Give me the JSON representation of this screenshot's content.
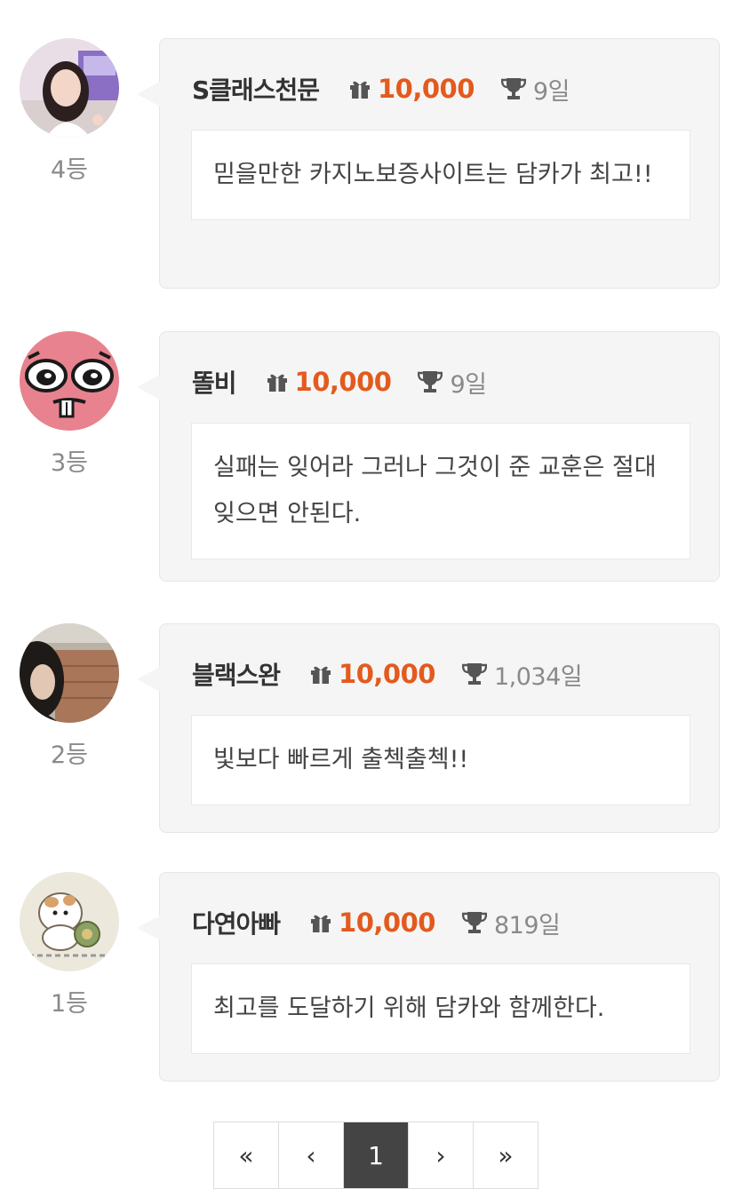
{
  "entries": [
    {
      "name": "S클래스천문",
      "points": "10,000",
      "days": "9일",
      "message": "믿을만한 카지노보증사이트는 담카가 최고!!",
      "rank": "4등",
      "avatar_icon": "profile-photo-woman-icon"
    },
    {
      "name": "똘비",
      "points": "10,000",
      "days": "9일",
      "message": "실패는 잊어라 그러나 그것이 준 교훈은 절대 잊으면 안된다.",
      "rank": "3등",
      "avatar_icon": "pink-cartoon-face-icon"
    },
    {
      "name": "블랙스완",
      "points": "10,000",
      "days": "1,034일",
      "message": "빛보다 빠르게 출첵출첵!!",
      "rank": "2등",
      "avatar_icon": "profile-photo-person-icon"
    },
    {
      "name": "다연아빠",
      "points": "10,000",
      "days": "819일",
      "message": "최고를 도달하기 위해 담카와 함께한다.",
      "rank": "1등",
      "avatar_icon": "cartoon-hamster-icon"
    }
  ],
  "pagination": {
    "first": "«",
    "prev": "‹",
    "current": "1",
    "next": "›",
    "last": "»"
  },
  "colors": {
    "points": "#e35a1e",
    "card_bg": "#f5f5f5",
    "active_page": "#444444"
  }
}
